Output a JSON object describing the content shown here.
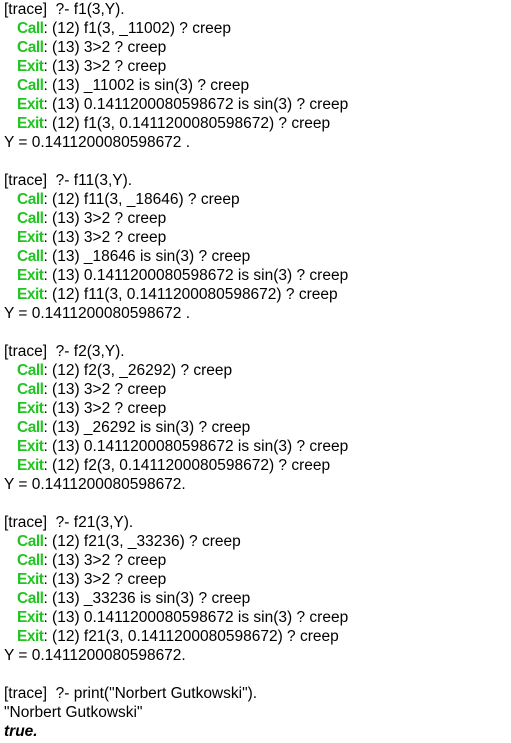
{
  "console": {
    "lines": [
      {
        "kind": "query",
        "text": "[trace]  ?- f1(3,Y)."
      },
      {
        "kind": "port",
        "port": "Call",
        "text": " (12) f1(3, _11002) ? creep"
      },
      {
        "kind": "port",
        "port": "Call",
        "text": " (13) 3>2 ? creep"
      },
      {
        "kind": "port",
        "port": "Exit",
        "text": " (13) 3>2 ? creep"
      },
      {
        "kind": "port",
        "port": "Call",
        "text": " (13) _11002 is sin(3) ? creep"
      },
      {
        "kind": "port",
        "port": "Exit",
        "text": " (13) 0.1411200080598672 is sin(3) ? creep"
      },
      {
        "kind": "port",
        "port": "Exit",
        "text": " (12) f1(3, 0.1411200080598672) ? creep"
      },
      {
        "kind": "result",
        "text": "Y = 0.1411200080598672 ."
      },
      {
        "kind": "blank"
      },
      {
        "kind": "query",
        "text": "[trace]  ?- f11(3,Y)."
      },
      {
        "kind": "port",
        "port": "Call",
        "text": " (12) f11(3, _18646) ? creep"
      },
      {
        "kind": "port",
        "port": "Call",
        "text": " (13) 3>2 ? creep"
      },
      {
        "kind": "port",
        "port": "Exit",
        "text": " (13) 3>2 ? creep"
      },
      {
        "kind": "port",
        "port": "Call",
        "text": " (13) _18646 is sin(3) ? creep"
      },
      {
        "kind": "port",
        "port": "Exit",
        "text": " (13) 0.1411200080598672 is sin(3) ? creep"
      },
      {
        "kind": "port",
        "port": "Exit",
        "text": " (12) f11(3, 0.1411200080598672) ? creep"
      },
      {
        "kind": "result",
        "text": "Y = 0.1411200080598672 ."
      },
      {
        "kind": "blank"
      },
      {
        "kind": "query",
        "text": "[trace]  ?- f2(3,Y)."
      },
      {
        "kind": "port",
        "port": "Call",
        "text": " (12) f2(3, _26292) ? creep"
      },
      {
        "kind": "port",
        "port": "Call",
        "text": " (13) 3>2 ? creep"
      },
      {
        "kind": "port",
        "port": "Exit",
        "text": " (13) 3>2 ? creep"
      },
      {
        "kind": "port",
        "port": "Call",
        "text": " (13) _26292 is sin(3) ? creep"
      },
      {
        "kind": "port",
        "port": "Exit",
        "text": " (13) 0.1411200080598672 is sin(3) ? creep"
      },
      {
        "kind": "port",
        "port": "Exit",
        "text": " (12) f2(3, 0.1411200080598672) ? creep"
      },
      {
        "kind": "result",
        "text": "Y = 0.1411200080598672."
      },
      {
        "kind": "blank"
      },
      {
        "kind": "query",
        "text": "[trace]  ?- f21(3,Y)."
      },
      {
        "kind": "port",
        "port": "Call",
        "text": " (12) f21(3, _33236) ? creep"
      },
      {
        "kind": "port",
        "port": "Call",
        "text": " (13) 3>2 ? creep"
      },
      {
        "kind": "port",
        "port": "Exit",
        "text": " (13) 3>2 ? creep"
      },
      {
        "kind": "port",
        "port": "Call",
        "text": " (13) _33236 is sin(3) ? creep"
      },
      {
        "kind": "port",
        "port": "Exit",
        "text": " (13) 0.1411200080598672 is sin(3) ? creep"
      },
      {
        "kind": "port",
        "port": "Exit",
        "text": " (12) f21(3, 0.1411200080598672) ? creep"
      },
      {
        "kind": "result",
        "text": "Y = 0.1411200080598672."
      },
      {
        "kind": "blank"
      },
      {
        "kind": "query",
        "text": "[trace]  ?- print(\"Norbert Gutkowski\")."
      },
      {
        "kind": "output",
        "text": "\"Norbert Gutkowski\""
      },
      {
        "kind": "final",
        "text": "true."
      }
    ]
  },
  "colors": {
    "port_green": "#22c422",
    "text": "#000000",
    "background": "#ffffff"
  }
}
